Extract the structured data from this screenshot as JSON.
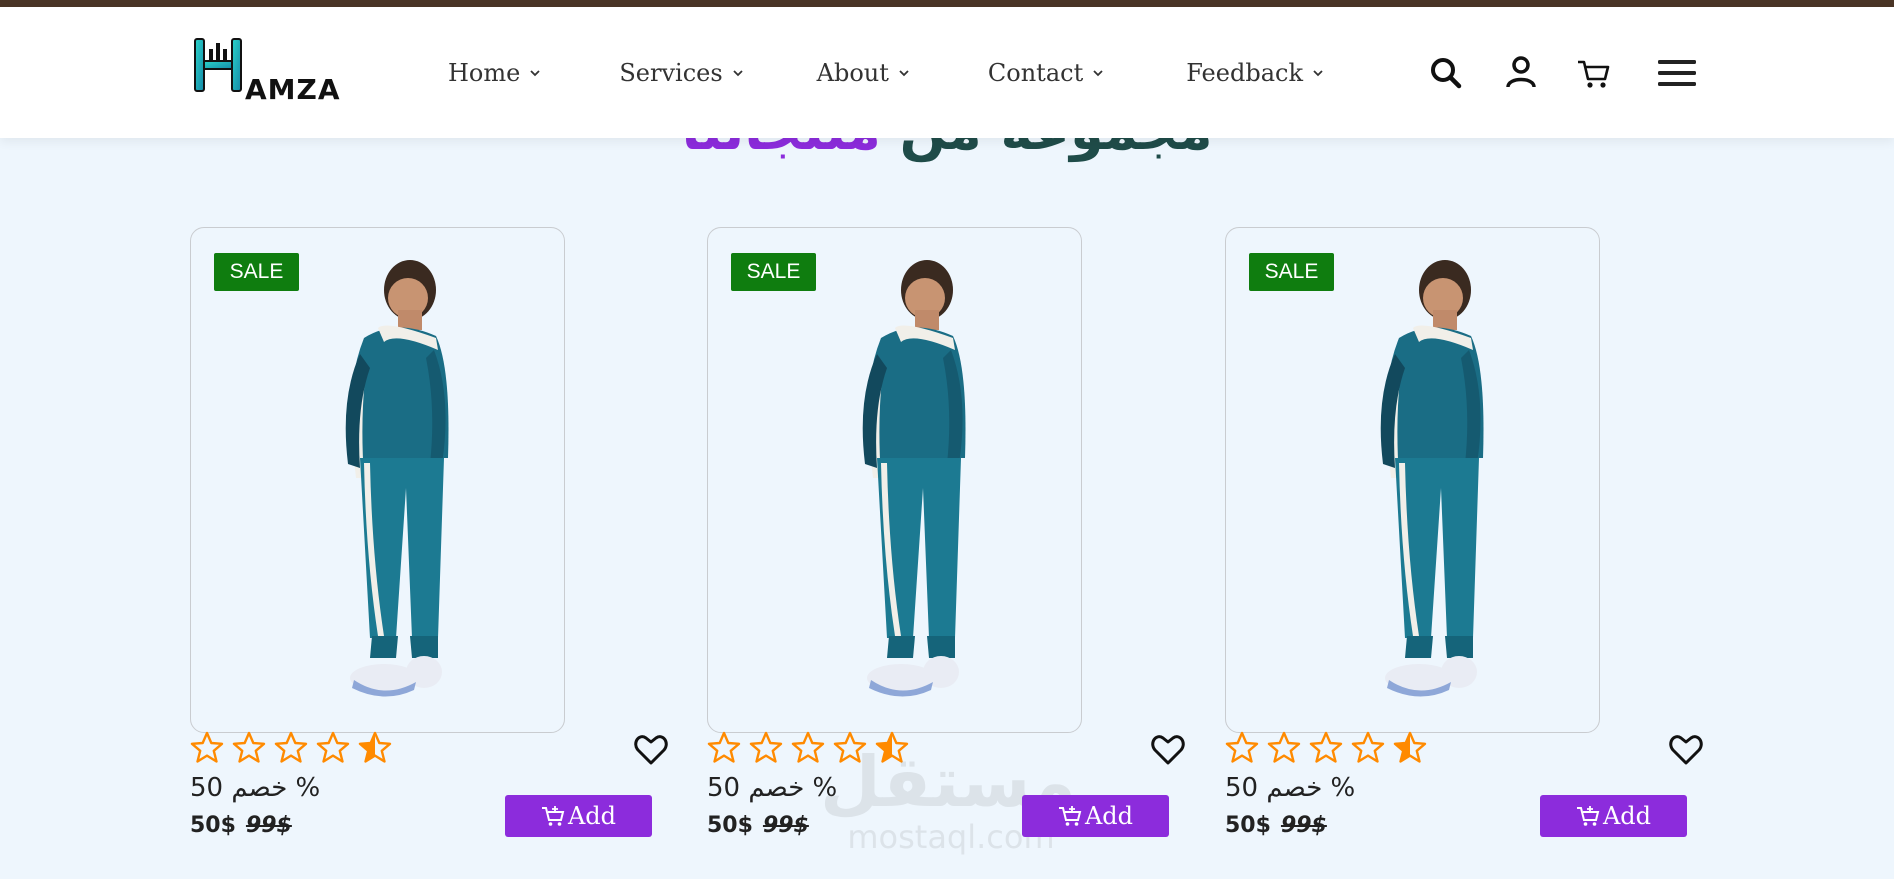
{
  "brand": {
    "logo_text": "AMZA"
  },
  "nav": {
    "items": [
      {
        "label": "Home"
      },
      {
        "label": "Services"
      },
      {
        "label": "About"
      },
      {
        "label": "Contact"
      },
      {
        "label": "Feedback"
      }
    ]
  },
  "header_icons": [
    "search-icon",
    "user-icon",
    "cart-icon",
    "menu-icon"
  ],
  "section": {
    "title_dark": "مجموعة من",
    "title_accent": "منتجاتنا"
  },
  "products": [
    {
      "badge": "SALE",
      "rating": 4.5,
      "discount": "50 خصم %",
      "price": "50$",
      "old_price": "99$",
      "add_label": "Add"
    },
    {
      "badge": "SALE",
      "rating": 4.5,
      "discount": "50 خصم %",
      "price": "50$",
      "old_price": "99$",
      "add_label": "Add"
    },
    {
      "badge": "SALE",
      "rating": 4.5,
      "discount": "50 خصم %",
      "price": "50$",
      "old_price": "99$",
      "add_label": "Add"
    }
  ],
  "watermark": {
    "arabic": "مستقل",
    "latin": "mostaql.com"
  },
  "colors": {
    "accent": "#8c2cdc",
    "sale": "#0f7d0f",
    "star": "#ff8a00",
    "background": "#eef6fd",
    "top_strip": "#4a3526",
    "heading": "#1f4c49"
  }
}
